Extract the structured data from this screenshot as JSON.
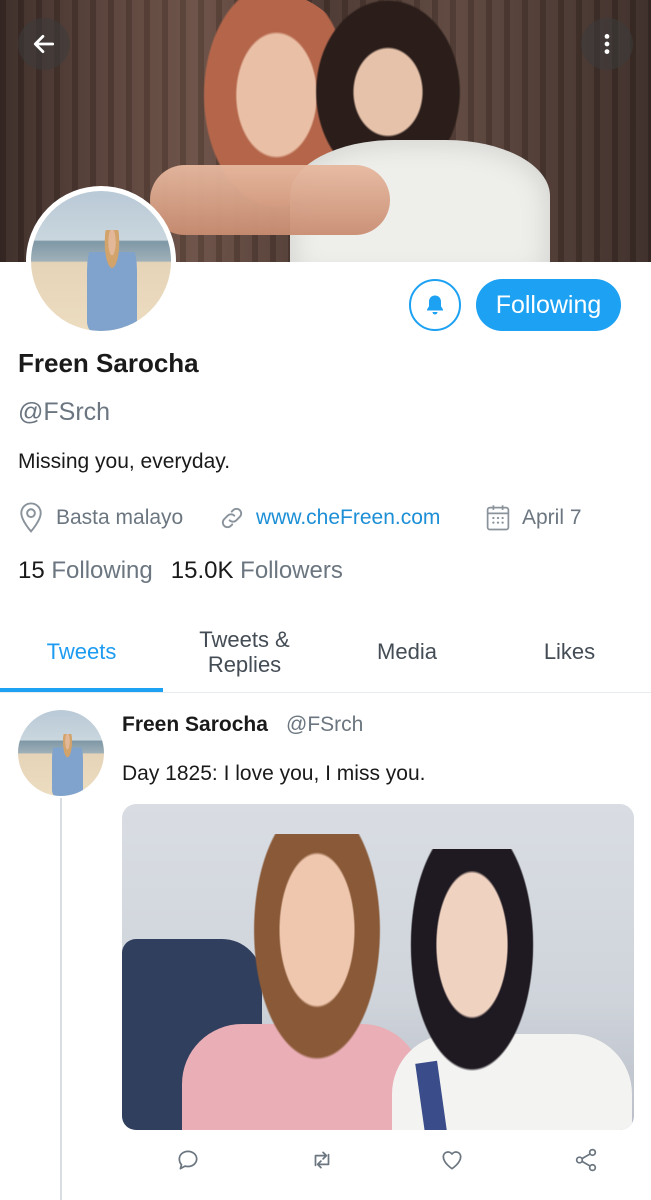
{
  "header": {
    "back_icon": "back-arrow-icon",
    "more_icon": "more-vertical-icon"
  },
  "profile": {
    "name": "Freen Sarocha",
    "handle": "@FSrch",
    "bio": "Missing you, everyday.",
    "location": "Basta malayo",
    "website": "www.cheFreen.com",
    "joined": "April 7",
    "following_count": "15",
    "following_label": "Following",
    "followers_count": "15.0K",
    "followers_label": "Followers"
  },
  "actions": {
    "notify_icon": "bell-icon",
    "follow_label": "Following"
  },
  "tabs": [
    {
      "label": "Tweets",
      "active": true
    },
    {
      "label": "Tweets & Replies",
      "active": false
    },
    {
      "label": "Media",
      "active": false
    },
    {
      "label": "Likes",
      "active": false
    }
  ],
  "tweet": {
    "name": "Freen Sarocha",
    "handle": "@FSrch",
    "text": "Day 1825: I love you, I miss you.",
    "icons": [
      "reply-icon",
      "retweet-icon",
      "like-icon",
      "share-icon"
    ]
  },
  "colors": {
    "accent": "#1da1f2",
    "link": "#1d8fd6",
    "muted": "#6b7680"
  }
}
